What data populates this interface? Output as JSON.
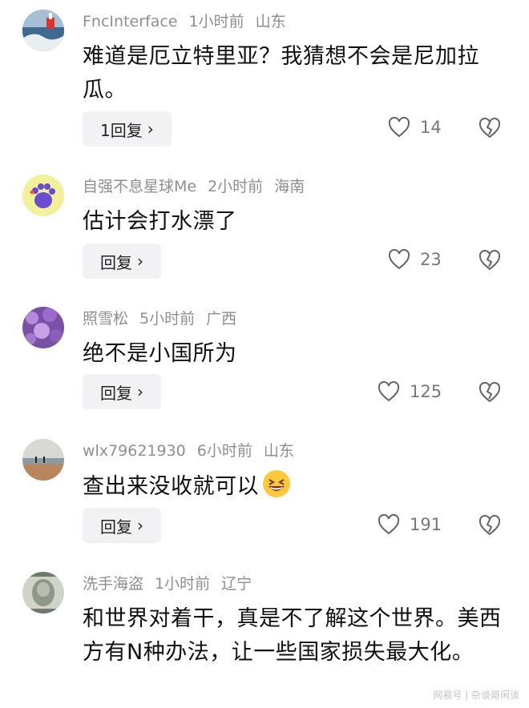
{
  "comments": [
    {
      "username": "FncInterface",
      "time": "1小时前",
      "location": "山东",
      "text": "难道是厄立特里亚？我猜想不会是尼加拉瓜。",
      "reply_label": "1回复",
      "likes": "14",
      "avatar_icon": "seaside-landscape-avatar"
    },
    {
      "username": "自强不息星球Me",
      "time": "2小时前",
      "location": "海南",
      "text": "估计会打水漂了",
      "reply_label": "回复",
      "likes": "23",
      "avatar_icon": "purple-paw-avatar"
    },
    {
      "username": "照雪松",
      "time": "5小时前",
      "location": "广西",
      "text": "绝不是小国所为",
      "reply_label": "回复",
      "likes": "125",
      "avatar_icon": "lavender-flowers-avatar"
    },
    {
      "username": "wlx79621930",
      "time": "6小时前",
      "location": "山东",
      "text": "查出来没收就可以",
      "reply_label": "回复",
      "likes": "191",
      "avatar_icon": "beach-avatar"
    },
    {
      "username": "洗手海盗",
      "time": "1小时前",
      "location": "辽宁",
      "text": "和世界对着干，真是不了解这个世界。美西方有N种办法，让一些国家损失最大化。",
      "avatar_icon": "dollar-bill-avatar"
    }
  ],
  "watermark": "网易号 | 杂谈哥闲谈",
  "colors": {
    "meta": "#8e8e93",
    "button_bg": "#f2f2f4",
    "text": "#111111"
  }
}
